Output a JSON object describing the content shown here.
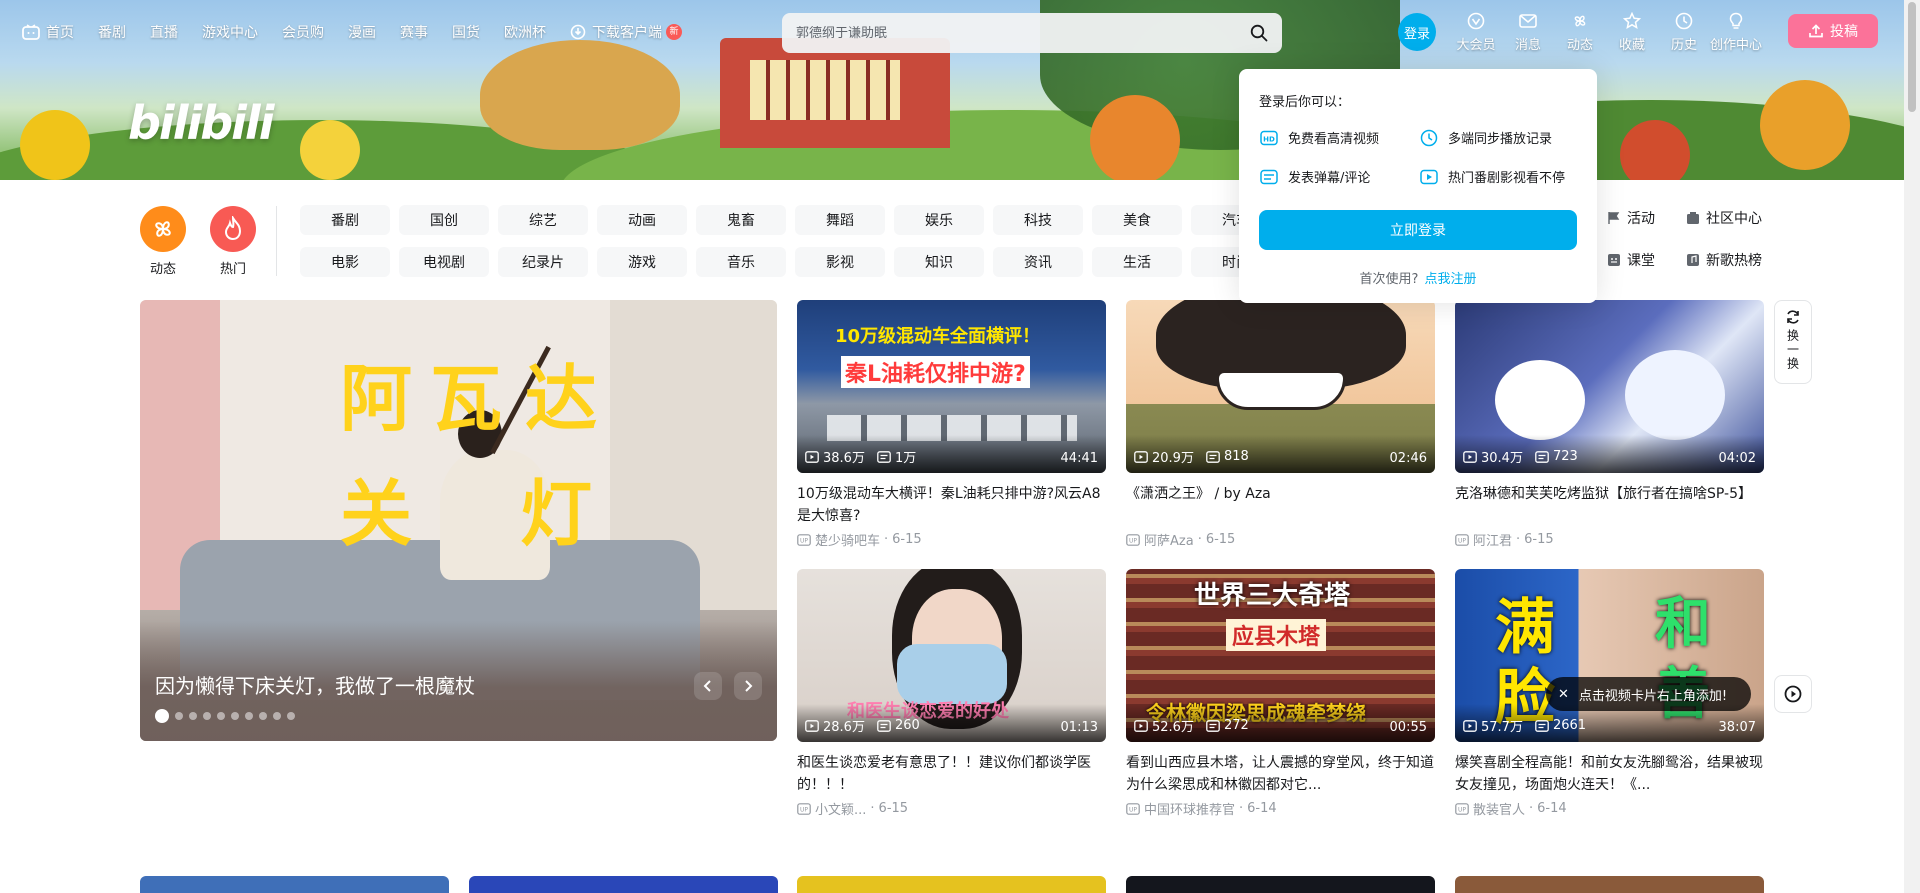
{
  "nav": {
    "left": [
      {
        "label": "首页",
        "icon": "tv-icon"
      },
      {
        "label": "番剧"
      },
      {
        "label": "直播"
      },
      {
        "label": "游戏中心"
      },
      {
        "label": "会员购"
      },
      {
        "label": "漫画"
      },
      {
        "label": "赛事"
      },
      {
        "label": "国货"
      },
      {
        "label": "欧洲杯"
      },
      {
        "label": "下载客户端",
        "icon": "download-icon",
        "badge": "新"
      }
    ],
    "search_placeholder": "郭德纲于谦助眠",
    "login": "登录",
    "right": [
      {
        "label": "大会员"
      },
      {
        "label": "消息"
      },
      {
        "label": "动态"
      },
      {
        "label": "收藏"
      },
      {
        "label": "历史"
      },
      {
        "label": "创作中心"
      }
    ],
    "upload": "投稿"
  },
  "logo": "bilibili",
  "channels": {
    "dynamic": "动态",
    "hot": "热门",
    "row1": [
      "番剧",
      "国创",
      "综艺",
      "动画",
      "鬼畜",
      "舞蹈",
      "娱乐",
      "科技",
      "美食",
      "汽车"
    ],
    "row2": [
      "电影",
      "电视剧",
      "纪录片",
      "游戏",
      "音乐",
      "影视",
      "知识",
      "资讯",
      "生活",
      "时尚"
    ],
    "extra1": [
      {
        "label": "活动",
        "icon": "flag-icon"
      },
      {
        "label": "社区中心",
        "icon": "community-icon"
      }
    ],
    "extra2": [
      {
        "label": "课堂",
        "icon": "classroom-icon"
      },
      {
        "label": "新歌热榜",
        "icon": "music-chart-icon"
      }
    ]
  },
  "popup": {
    "title": "登录后你可以：",
    "features": [
      {
        "label": "免费看高清视频",
        "icon": "hd-icon"
      },
      {
        "label": "多端同步播放记录",
        "icon": "clock-icon"
      },
      {
        "label": "发表弹幕/评论",
        "icon": "danmaku-icon"
      },
      {
        "label": "热门番剧影视看不停",
        "icon": "play-icon"
      }
    ],
    "button": "立即登录",
    "first_time": "首次使用?",
    "register": "点我注册"
  },
  "carousel": {
    "caption": "因为懒得下床关灯，我做了一根魔杖",
    "overlay_text": [
      "阿",
      "瓦",
      "达",
      "关",
      "灯"
    ],
    "dots": 10,
    "active_dot": 0
  },
  "videos": [
    {
      "title": "10万级混动车大横评！秦L油耗只排中游?风云A8是大惊喜?",
      "views": "38.6万",
      "danmaku": "1万",
      "duration": "44:41",
      "author": "楚少骑吧车",
      "date": "6-15",
      "thumb_text": [
        "10万级混动车全面横评！",
        "秦L油耗仅排中游?"
      ]
    },
    {
      "title": "《潇洒之王》 / by Aza",
      "views": "20.9万",
      "danmaku": "818",
      "duration": "02:46",
      "author": "阿萨Aza",
      "date": "6-15"
    },
    {
      "title": "克洛琳德和芙芙吃烤监狱【旅行者在搞啥SP-5】",
      "views": "30.4万",
      "danmaku": "723",
      "duration": "04:02",
      "author": "阿江君",
      "date": "6-15"
    },
    {
      "title": "和医生谈恋爱老有意思了！！建议你们都谈学医的！！！",
      "views": "28.6万",
      "danmaku": "260",
      "duration": "01:13",
      "author": "小文颖...",
      "date": "6-15",
      "thumb_text": [
        "和医生谈恋爱的好处"
      ]
    },
    {
      "title": "看到山西应县木塔，让人震撼的穿堂风，终于知道为什么梁思成和林徽因都对它...",
      "views": "52.6万",
      "danmaku": "272",
      "duration": "00:55",
      "author": "中国环球推荐官",
      "date": "6-14",
      "thumb_text": [
        "世界三大奇塔",
        "应县木塔",
        "令林徽因梁思成魂牵梦绕"
      ]
    },
    {
      "title": "爆笑喜剧全程高能！和前女友洗腳鸳浴，结果被现女友撞见，场面炮火连天！《...",
      "views": "57.7万",
      "danmaku": "2661",
      "duration": "38:07",
      "author": "散装官人",
      "date": "6-14",
      "thumb_text": [
        "满",
        "和",
        "脸",
        "善"
      ]
    }
  ],
  "refresh_label": "换一换",
  "toast": "点击视频卡片右上角添加!"
}
